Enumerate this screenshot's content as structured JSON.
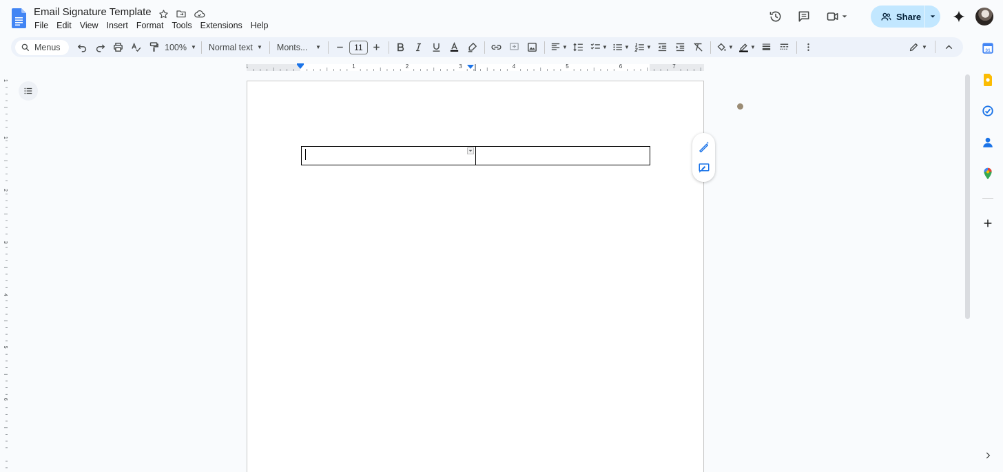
{
  "header": {
    "title": "Email Signature Template",
    "menu": [
      "File",
      "Edit",
      "View",
      "Insert",
      "Format",
      "Tools",
      "Extensions",
      "Help"
    ],
    "share_label": "Share"
  },
  "toolbar": {
    "search_label": "Menus",
    "zoom": "100%",
    "style": "Normal text",
    "font": "Monts...",
    "font_size": "11"
  },
  "ruler": {
    "top_numbers": [
      "1",
      "1",
      "2",
      "3",
      "4",
      "5",
      "6",
      "7"
    ],
    "left_numbers": [
      "1",
      "1",
      "2",
      "3",
      "4",
      "5",
      "6"
    ]
  },
  "document": {
    "table": {
      "rows": 1,
      "cols": 2,
      "cells": [
        "",
        ""
      ]
    }
  },
  "colors": {
    "accent": "#1a73e8",
    "share_bg": "#c2e7ff",
    "toolbar_bg": "#edf2fa",
    "page_bg": "#f9fbfd"
  },
  "icons": {
    "title_row": [
      "star-icon",
      "move-to-folder-icon",
      "cloud-saved-icon"
    ],
    "header_right": [
      "version-history-icon",
      "comments-icon",
      "meet-icon",
      "gemini-icon"
    ],
    "rail": [
      "calendar-icon",
      "keep-icon",
      "tasks-icon",
      "contacts-icon",
      "maps-icon",
      "add-icon",
      "expand-panel-icon"
    ]
  }
}
